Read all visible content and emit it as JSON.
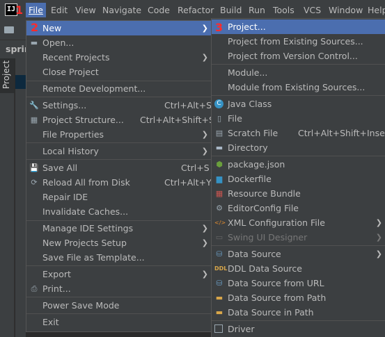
{
  "menubar": {
    "logo": "IJ",
    "items": [
      "File",
      "Edit",
      "View",
      "Navigate",
      "Code",
      "Refactor",
      "Build",
      "Run",
      "Tools",
      "VCS",
      "Window",
      "Help"
    ]
  },
  "badges": [
    "1",
    "2",
    "3"
  ],
  "background": {
    "breadcrumb": "sprin",
    "project_tab": "Project"
  },
  "file_menu": {
    "new": "New",
    "open": "Open...",
    "recent_projects": "Recent Projects",
    "close_project": "Close Project",
    "remote_development": "Remote Development...",
    "settings": "Settings...",
    "settings_shortcut": "Ctrl+Alt+S",
    "project_structure": "Project Structure...",
    "project_structure_shortcut": "Ctrl+Alt+Shift+S",
    "file_properties": "File Properties",
    "local_history": "Local History",
    "save_all": "Save All",
    "save_all_shortcut": "Ctrl+S",
    "reload_from_disk": "Reload All from Disk",
    "reload_shortcut": "Ctrl+Alt+Y",
    "repair_ide": "Repair IDE",
    "invalidate_caches": "Invalidate Caches...",
    "manage_ide_settings": "Manage IDE Settings",
    "new_projects_setup": "New Projects Setup",
    "save_file_as_template": "Save File as Template...",
    "export": "Export",
    "print": "Print...",
    "power_save_mode": "Power Save Mode",
    "exit": "Exit"
  },
  "new_menu": {
    "project": "Project...",
    "project_from_existing": "Project from Existing Sources...",
    "project_from_vcs": "Project from Version Control...",
    "module": "Module...",
    "module_from_existing": "Module from Existing Sources...",
    "java_class": "Java Class",
    "file": "File",
    "scratch_file": "Scratch File",
    "scratch_shortcut": "Ctrl+Alt+Shift+Insert",
    "directory": "Directory",
    "package_json": "package.json",
    "dockerfile": "Dockerfile",
    "resource_bundle": "Resource Bundle",
    "editorconfig": "EditorConfig File",
    "xml_config": "XML Configuration File",
    "swing_ui": "Swing UI Designer",
    "data_source": "Data Source",
    "ddl_data_source": "DDL Data Source",
    "ds_from_url": "Data Source from URL",
    "ds_from_path": "Data Source from Path",
    "ds_in_path": "Data Source in Path",
    "driver": "Driver"
  },
  "colors": {
    "accent": "#4b6eaf",
    "badge": "#ff2b2b",
    "menu_bg": "#3c3f41"
  }
}
